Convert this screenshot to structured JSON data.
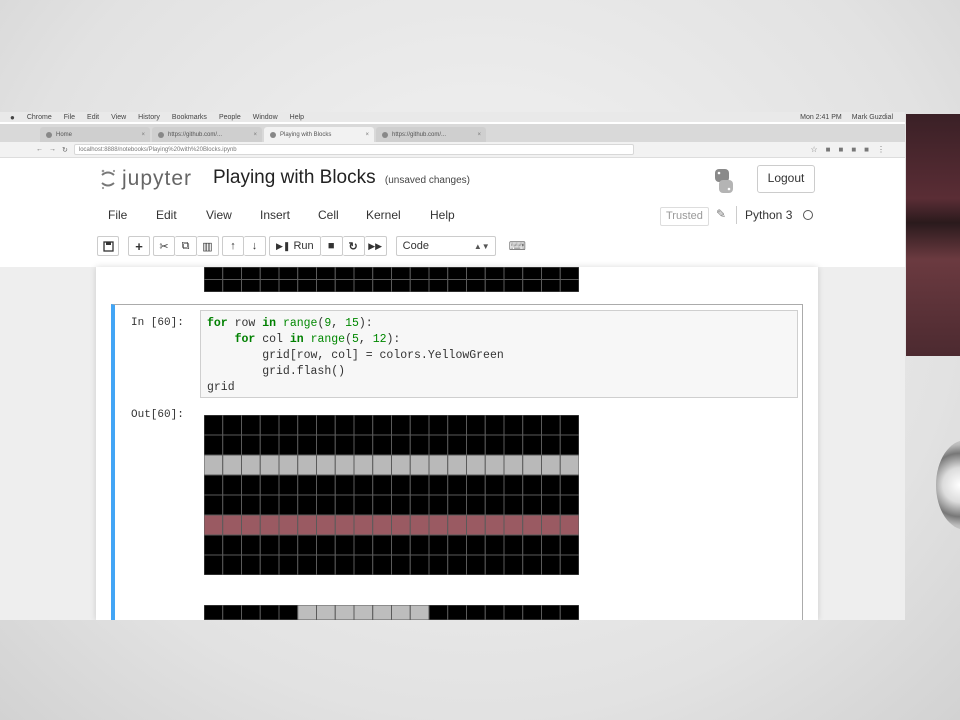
{
  "mac_menubar": {
    "items": [
      "Chrome",
      "File",
      "Edit",
      "View",
      "History",
      "Bookmarks",
      "People",
      "Window",
      "Help"
    ],
    "right": [
      "Mon 2:41 PM",
      "Mark Guzdial"
    ]
  },
  "browser": {
    "tabs": [
      {
        "label": "Home",
        "active": false
      },
      {
        "label": "https://github.com/...",
        "active": false
      },
      {
        "label": "Playing with Blocks",
        "active": true
      },
      {
        "label": "https://github.com/...",
        "active": false
      }
    ],
    "address": "localhost:8888/notebooks/Playing%20with%20Blocks.ipynb"
  },
  "jupyter": {
    "logo_text": "jupyter",
    "notebook_title": "Playing with Blocks",
    "save_status": "(unsaved changes)",
    "logout_label": "Logout",
    "menus": [
      "File",
      "Edit",
      "View",
      "Insert",
      "Cell",
      "Kernel",
      "Help"
    ],
    "trusted_label": "Trusted",
    "kernel_name": "Python 3",
    "toolbar": {
      "run_label": "Run",
      "cell_type": "Code"
    }
  },
  "cell": {
    "in_prompt": "In [60]:",
    "out_prompt": "Out[60]:",
    "code_lines": [
      "for row in range(9, 15):",
      "    for col in range(5, 12):",
      "        grid[row, col] = colors.YellowGreen",
      "        grid.flash()",
      "grid"
    ]
  },
  "colors": {
    "cell_border_active": "#42a5f5",
    "grid_black": "#000000",
    "grid_line": "#5a5a5a",
    "row_highlight_gray": "#b9b9b9",
    "row_highlight_mauve": "#9a5a62",
    "block_gray": "#bdbdbd"
  },
  "grids": {
    "top_partial": {
      "cols": 20,
      "rows": 2,
      "highlight_rows": []
    },
    "output": {
      "cols": 20,
      "rows": 8,
      "highlight_rows": [
        {
          "row": 2,
          "color": "row_highlight_gray"
        },
        {
          "row": 5,
          "color": "row_highlight_mauve"
        }
      ]
    },
    "bottom_partial": {
      "cols": 20,
      "rows": 1,
      "gray_cols_start": 5,
      "gray_cols_end": 12
    }
  }
}
